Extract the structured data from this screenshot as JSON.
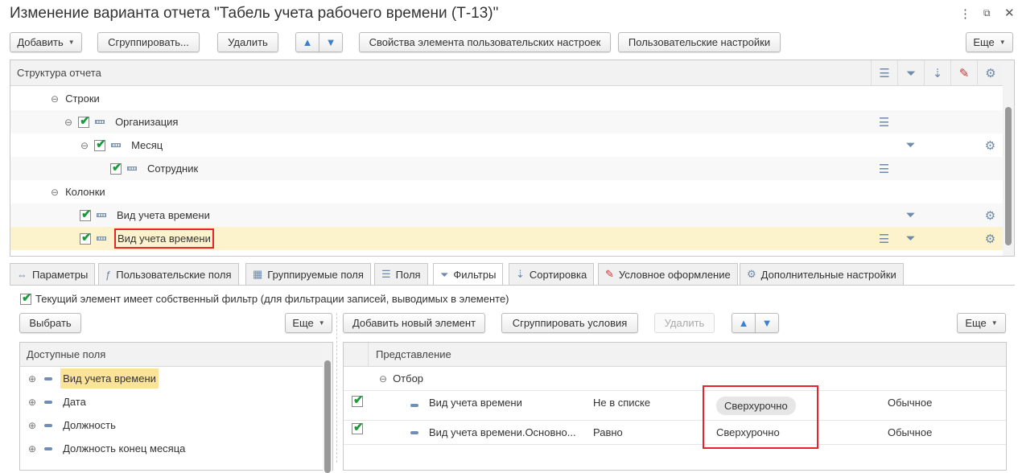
{
  "title": "Изменение варианта отчета \"Табель учета рабочего времени (Т-13)\"",
  "window": {
    "menu_icon": "more-vert-icon",
    "restore_icon": "restore-icon",
    "close_icon": "close-icon"
  },
  "toolbar": {
    "add": "Добавить",
    "group": "Сгруппировать...",
    "delete": "Удалить",
    "up": "🡅",
    "down": "🡇",
    "props": "Свойства элемента пользовательских настроек",
    "user_settings": "Пользовательские настройки",
    "more": "Еще"
  },
  "structure": {
    "header": "Структура отчета",
    "rows": [
      {
        "label": "Строки"
      },
      {
        "label": "Организация"
      },
      {
        "label": "Месяц"
      },
      {
        "label": "Сотрудник"
      },
      {
        "label": "Колонки"
      },
      {
        "label": "Вид учета времени"
      },
      {
        "label": "Вид учета времени"
      }
    ]
  },
  "tabs": [
    "Параметры",
    "Пользовательские поля",
    "Группируемые поля",
    "Поля",
    "Фильтры",
    "Сортировка",
    "Условное оформление",
    "Дополнительные настройки"
  ],
  "filters": {
    "own_filter": "Текущий элемент имеет собственный фильтр (для фильтрации записей, выводимых в элементе)",
    "left": {
      "select": "Выбрать",
      "more": "Еще",
      "header": "Доступные поля",
      "items": [
        "Вид учета времени",
        "Дата",
        "Должность",
        "Должность конец месяца"
      ]
    },
    "right": {
      "add": "Добавить новый элемент",
      "group": "Сгруппировать условия",
      "delete": "Удалить",
      "more": "Еще",
      "header": "Представление",
      "group_label": "Отбор",
      "rows": [
        {
          "field": "Вид учета времени",
          "cond": "Не в списке",
          "value": "Сверхурочно",
          "mode": "Обычное"
        },
        {
          "field": "Вид учета времени.Основно...",
          "cond": "Равно",
          "value": "Сверхурочно",
          "mode": "Обычное"
        }
      ]
    }
  },
  "colors": {
    "highlight": "#e8232a",
    "selected": "#fcf2cc",
    "check": "#1a9a3a"
  }
}
